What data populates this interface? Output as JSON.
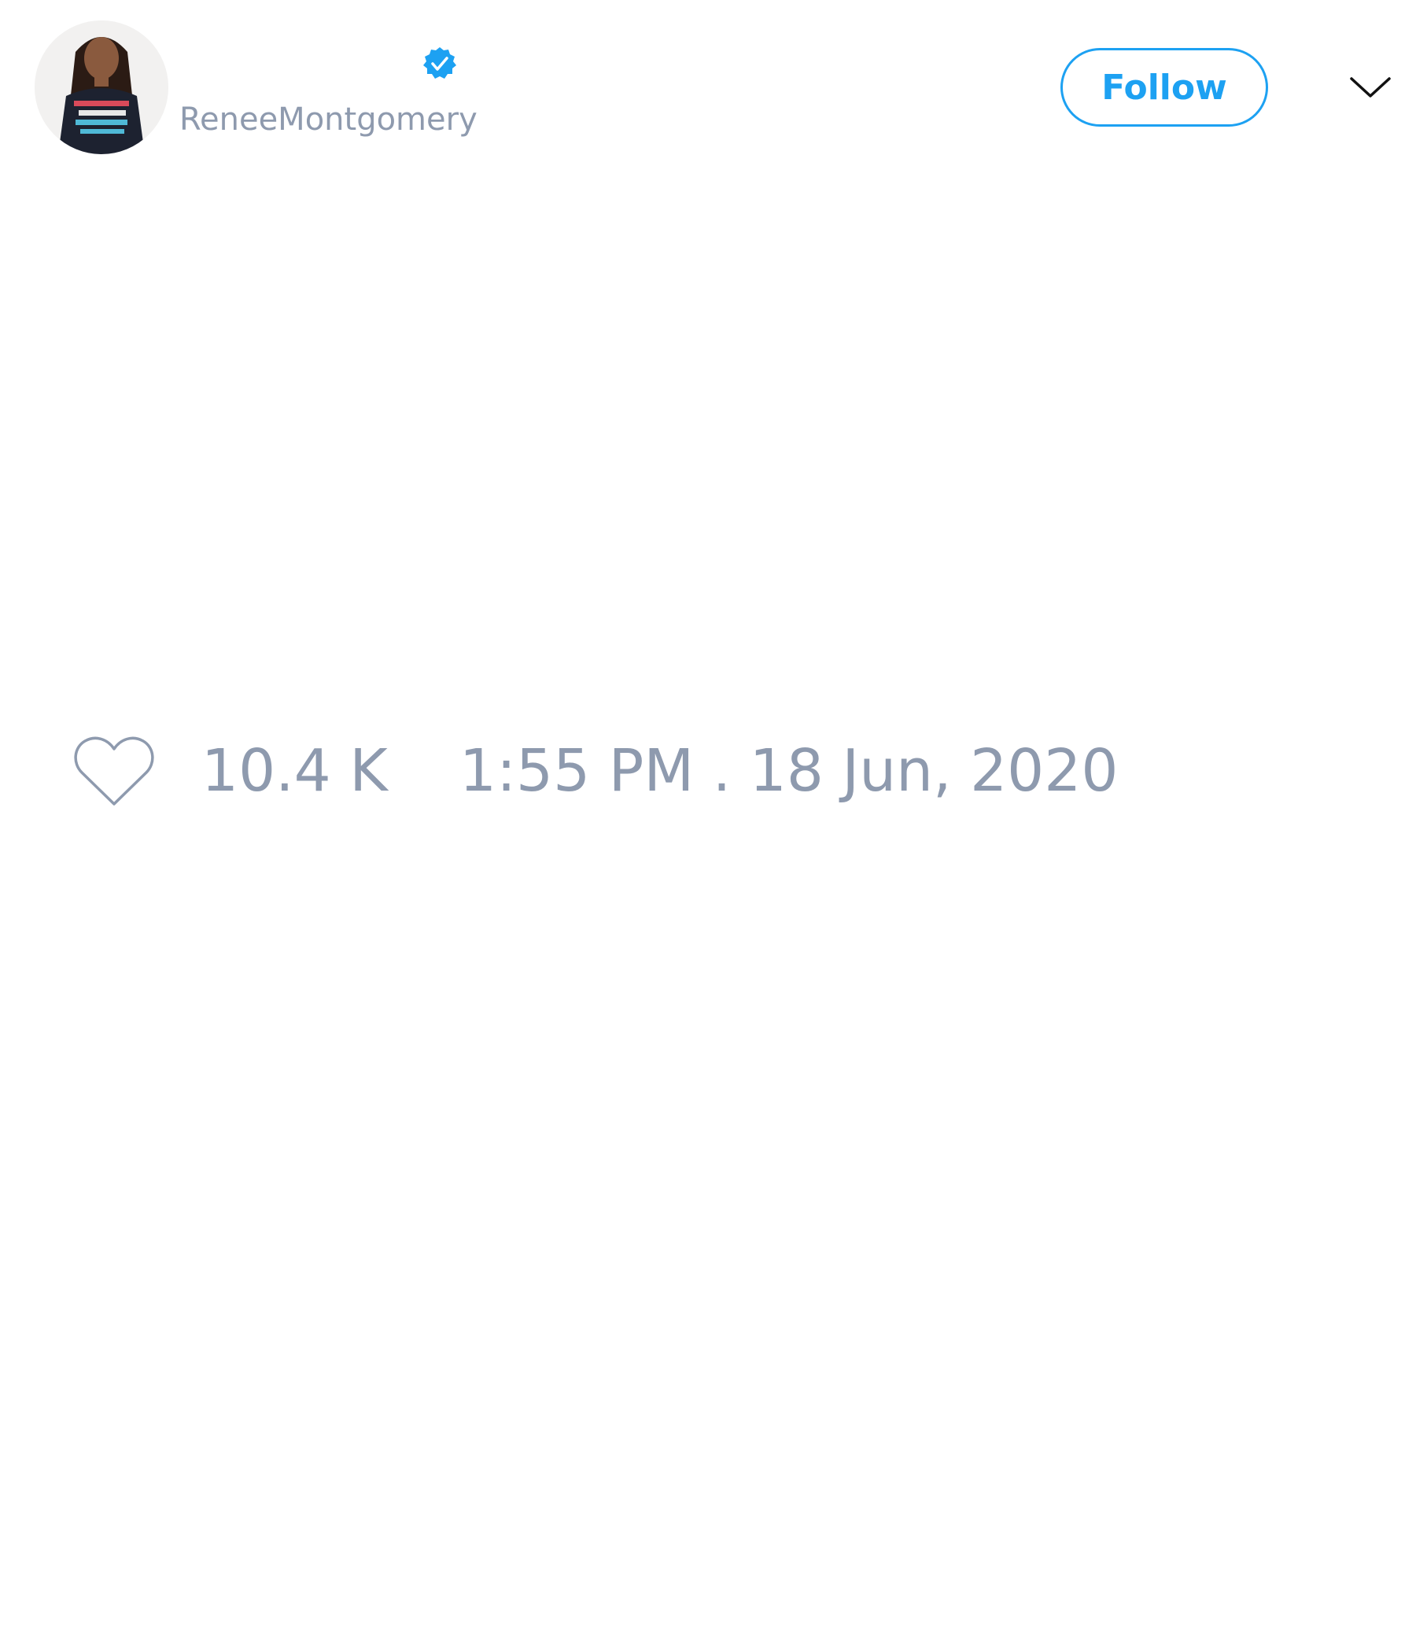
{
  "author": {
    "handle": "ReneeMontgomery",
    "verified": true,
    "avatar": "profile-photo"
  },
  "actions": {
    "follow_label": "Follow"
  },
  "footer": {
    "like_count": "10.4 K",
    "timestamp": "1:55 PM . 18 Jun, 2020"
  },
  "icons": {
    "verified": "verified-badge-icon",
    "caret": "chevron-down-icon",
    "like": "heart-icon"
  },
  "colors": {
    "accent": "#1da1f2",
    "muted_text": "#8e9aae",
    "background": "#ffffff"
  }
}
